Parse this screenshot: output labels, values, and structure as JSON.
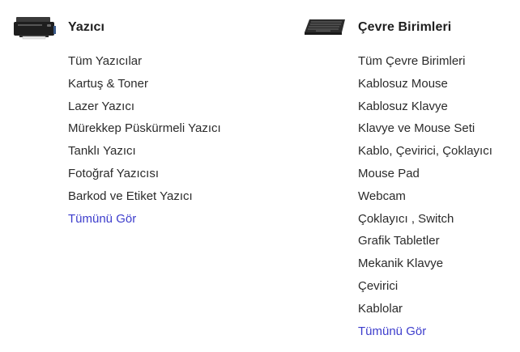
{
  "columns": [
    {
      "title": "Yazıcı",
      "icon": "printer-icon",
      "items": [
        "Tüm Yazıcılar",
        "Kartuş & Toner",
        "Lazer Yazıcı",
        "Mürekkep Püskürmeli Yazıcı",
        "Tanklı Yazıcı",
        "Fotoğraf Yazıcısı",
        "Barkod ve Etiket Yazıcı"
      ],
      "see_all": "Tümünü Gör"
    },
    {
      "title": "Çevre Birimleri",
      "icon": "keyboard-icon",
      "items": [
        "Tüm Çevre Birimleri",
        "Kablosuz Mouse",
        "Kablosuz Klavye",
        "Klavye ve Mouse Seti",
        "Kablo, Çevirici, Çoklayıcı",
        "Mouse Pad",
        "Webcam",
        "Çoklayıcı , Switch",
        "Grafik Tabletler",
        "Mekanik Klavye",
        "Çevirici",
        "Kablolar"
      ],
      "see_all": "Tümünü Gör"
    }
  ],
  "colors": {
    "link": "#3d3dcc",
    "text": "#2b2b2b"
  }
}
